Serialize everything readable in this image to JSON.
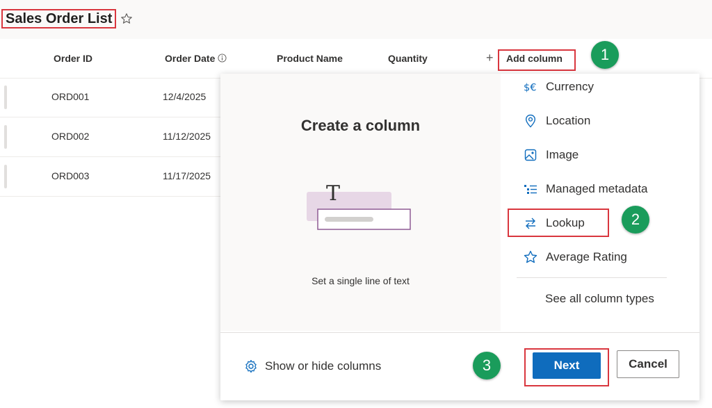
{
  "list": {
    "title": "Sales Order List"
  },
  "columns": {
    "order_id": "Order ID",
    "order_date": "Order Date",
    "product_name": "Product Name",
    "quantity": "Quantity",
    "add_column": "Add column"
  },
  "rows": [
    {
      "order_id": "ORD001",
      "order_date": "12/4/2025"
    },
    {
      "order_id": "ORD002",
      "order_date": "11/12/2025"
    },
    {
      "order_id": "ORD003",
      "order_date": "11/17/2025"
    }
  ],
  "panel": {
    "title": "Create a column",
    "description": "Set a single line of text",
    "types": [
      {
        "label": "Currency",
        "icon": "currency-icon"
      },
      {
        "label": "Location",
        "icon": "location-icon"
      },
      {
        "label": "Image",
        "icon": "image-icon"
      },
      {
        "label": "Managed metadata",
        "icon": "managed-metadata-icon"
      },
      {
        "label": "Lookup",
        "icon": "lookup-icon"
      },
      {
        "label": "Average Rating",
        "icon": "star-icon"
      }
    ],
    "see_all": "See all column types",
    "show_hide": "Show or hide columns",
    "next": "Next",
    "cancel": "Cancel"
  },
  "steps": [
    "1",
    "2",
    "3"
  ],
  "colors": {
    "accent": "#0f6cbd",
    "highlight": "#d9363e",
    "step_badge": "#1a9c5b",
    "illustration": "#8e5a94"
  }
}
